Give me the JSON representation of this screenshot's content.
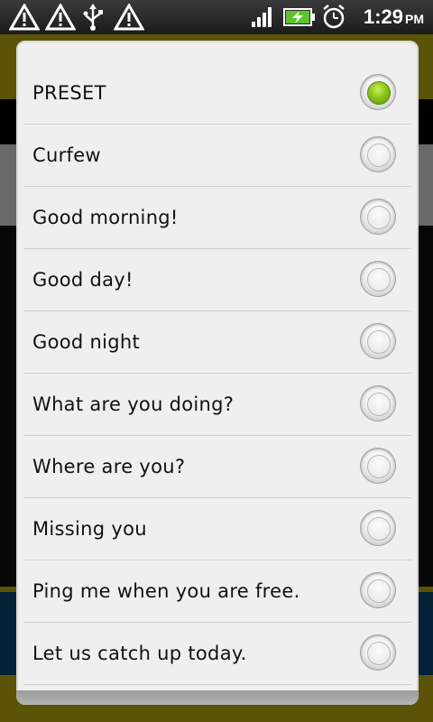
{
  "status_bar": {
    "time": "1:29",
    "ampm": "PM",
    "icons": [
      "warning-icon",
      "warning-icon",
      "usb-icon",
      "warning-icon",
      "signal-icon",
      "battery-charging-icon",
      "alarm-icon"
    ]
  },
  "dialog": {
    "options": [
      {
        "label": "PRESET",
        "selected": true
      },
      {
        "label": "Curfew",
        "selected": false
      },
      {
        "label": "Good morning!",
        "selected": false
      },
      {
        "label": "Good day!",
        "selected": false
      },
      {
        "label": "Good night",
        "selected": false
      },
      {
        "label": "What are you doing?",
        "selected": false
      },
      {
        "label": "Where are you?",
        "selected": false
      },
      {
        "label": "Missing you",
        "selected": false
      },
      {
        "label": "Ping me when you are free.",
        "selected": false
      },
      {
        "label": "Let us catch up today.",
        "selected": false
      }
    ]
  },
  "colors": {
    "selected_radio": "#8cc41a",
    "dialog_bg": "#efefef",
    "background_accent": "#c9b90f"
  }
}
